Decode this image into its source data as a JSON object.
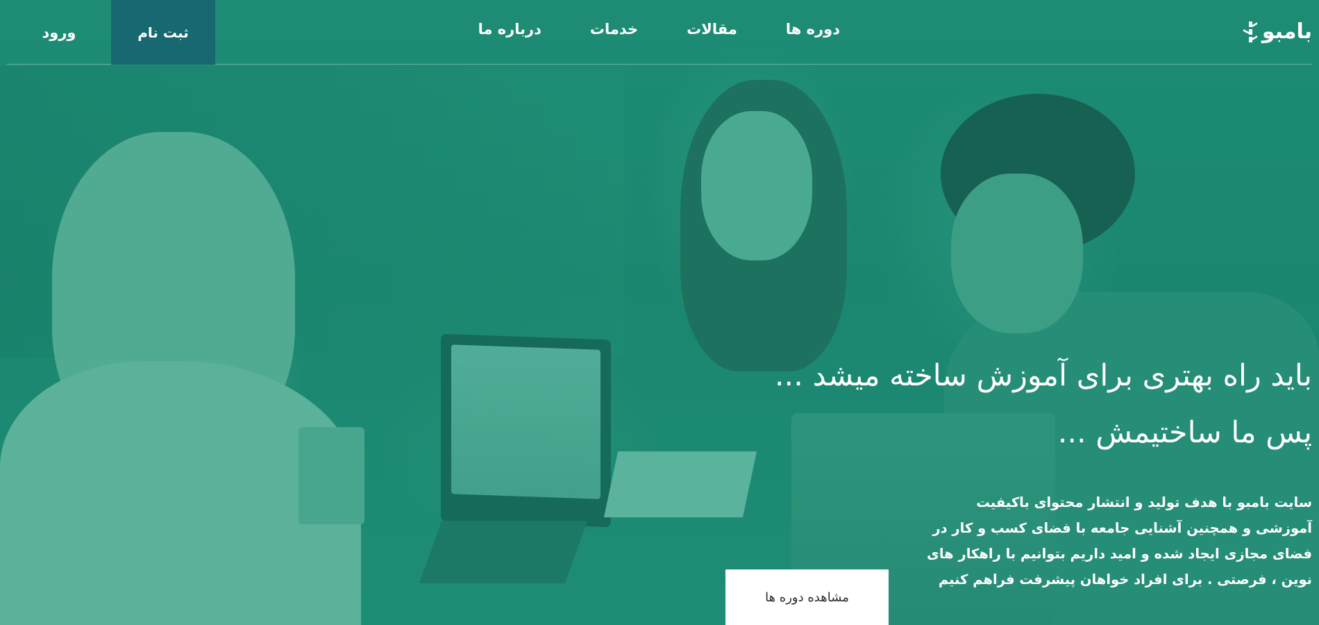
{
  "brand": {
    "logo_text": "بامبو",
    "logo_icon": "bamboo-icon"
  },
  "nav": {
    "items": [
      {
        "label": "دوره ها"
      },
      {
        "label": "مقالات"
      },
      {
        "label": "خدمات"
      },
      {
        "label": "درباره ما"
      }
    ],
    "login_label": "ورود",
    "register_label": "ثبت نام"
  },
  "hero": {
    "title_line1": "باید راه بهتری برای آموزش ساخته میشد ...",
    "title_line2": "پس ما ساختیمش ...",
    "description": "سایت بامبو با هدف تولید و انتشار محتوای باکیفیت آموزشی و همچنین آشنایی جامعه با فضای کسب و کار در فضای مجازی ایجاد شده و امید داریم بتوانیم با راهکار های نوین ، فرصتی . برای افراد خواهان پیشرفت فراهم کنیم",
    "cta_label": "مشاهده دوره ها"
  },
  "colors": {
    "hero_tint": "#1d8a74",
    "register_bg": "#176870",
    "cta_bg": "#ffffff"
  }
}
